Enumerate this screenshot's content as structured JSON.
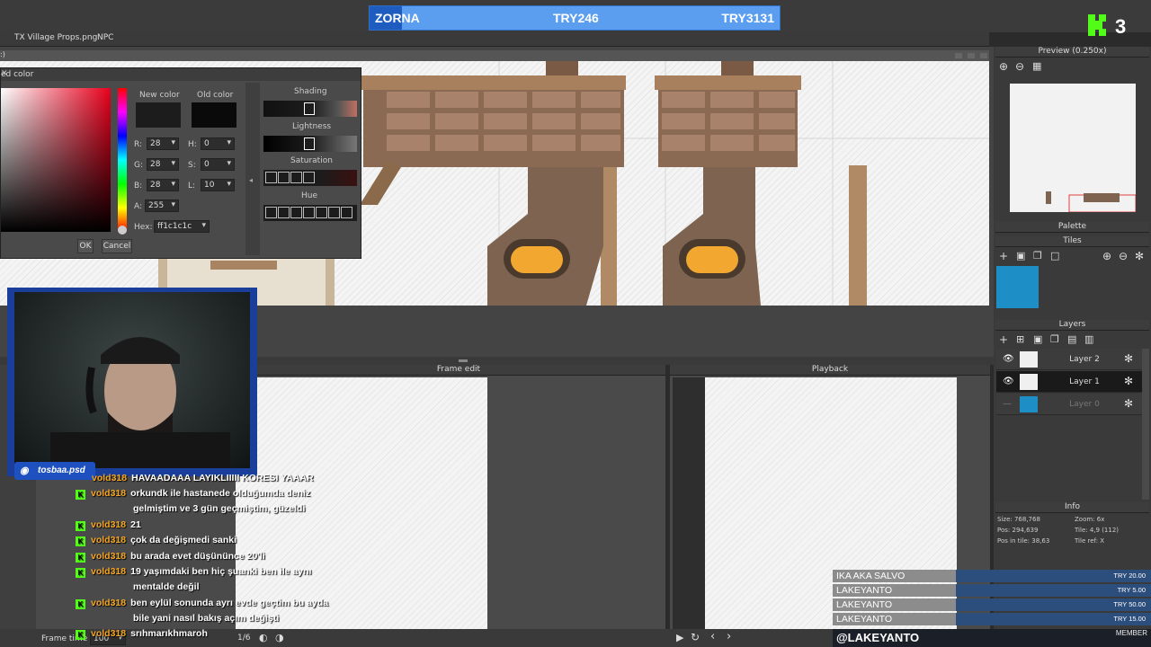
{
  "stream": {
    "donation_bar": {
      "left": "ZORNA",
      "center": "TRY246",
      "right": "TRY3131",
      "progress": 0.08
    },
    "kick_badge": "3",
    "discord": "tosbaa.psd",
    "handle": "@LAKEYANTO",
    "member_label": "MEMBER",
    "donations": [
      {
        "name": "IKA AKA SALVO",
        "amount": "TRY 20.00"
      },
      {
        "name": "LAKEYANTO",
        "amount": "TRY 5.00"
      },
      {
        "name": "LAKEYANTO",
        "amount": "TRY 50.00"
      },
      {
        "name": "LAKEYANTO",
        "amount": "TRY 15.00"
      }
    ]
  },
  "tabs": [
    {
      "label": "TX Village Props.png"
    },
    {
      "label": "NPC"
    }
  ],
  "canvas_label": ":)",
  "color_dialog": {
    "title": "ed color",
    "new_color_label": "New color",
    "old_color_label": "Old color",
    "new_color": "#1c1c1c",
    "old_color": "#0a0a0a",
    "fields": [
      {
        "label": "R:",
        "value": "28"
      },
      {
        "label": "G:",
        "value": "28"
      },
      {
        "label": "B:",
        "value": "28"
      },
      {
        "label": "A:",
        "value": "255"
      },
      {
        "label": "H:",
        "value": "0"
      },
      {
        "label": "S:",
        "value": "0"
      },
      {
        "label": "L:",
        "value": "10"
      }
    ],
    "hex_label": "Hex:",
    "hex_value": "ff1c1c1c",
    "ok_label": "OK",
    "cancel_label": "Cancel",
    "shading_label": "Shading",
    "lightness_label": "Lightness",
    "saturation_label": "Saturation",
    "hue_label": "Hue"
  },
  "panels": {
    "frame_edit": "Frame edit",
    "playback": "Playback",
    "frame_time_label": "Frame time",
    "frame_time_value": "100",
    "frame_counter": "1/6"
  },
  "right": {
    "preview_title": "Preview (0.250x)",
    "palette_title": "Palette",
    "tiles_title": "Tiles",
    "layers_title": "Layers",
    "layers": [
      {
        "name": "Layer 2",
        "selected": false
      },
      {
        "name": "Layer 1",
        "selected": true
      },
      {
        "name": "Layer 0",
        "selected": false
      }
    ],
    "info_title": "Info",
    "info": {
      "size": "Size: 768,768",
      "zoom": "Zoom: 6x",
      "pos": "Pos: 294,639",
      "tile": "Tile: 4,9 (112)",
      "pos_in_tile": "Pos in tile: 38,63",
      "tile_ref": "Tile ref: X"
    },
    "tile_color": "#1e8fc6"
  },
  "chat": [
    {
      "user": "vold318",
      "text": "HAVAADAAA LAYIKLIIIII KORESI YAAAR",
      "badge": false
    },
    {
      "user": "vold318",
      "text": "orkundk ile hastanede olduğumda deniz",
      "badge": true
    },
    {
      "user": "",
      "text": "gelmiştim ve 3 gün geçmiştim, güzeldi",
      "badge": false
    },
    {
      "user": "vold318",
      "text": "21",
      "badge": true
    },
    {
      "user": "vold318",
      "text": "çok da değişmedi sanki",
      "badge": true
    },
    {
      "user": "vold318",
      "text": "bu arada evet düşününce 20'li",
      "badge": true
    },
    {
      "user": "vold318",
      "text": "19 yaşımdaki ben hiç şuanki ben ile aynı",
      "badge": true
    },
    {
      "user": "",
      "text": "mentalde değil",
      "badge": false
    },
    {
      "user": "vold318",
      "text": "ben eylül sonunda ayrı evde geçtim bu ayda",
      "badge": true
    },
    {
      "user": "",
      "text": "bile yani nasıl bakış açım değişti",
      "badge": false
    },
    {
      "user": "vold318",
      "text": "srıhmarıkhmaroh",
      "badge": true
    }
  ]
}
